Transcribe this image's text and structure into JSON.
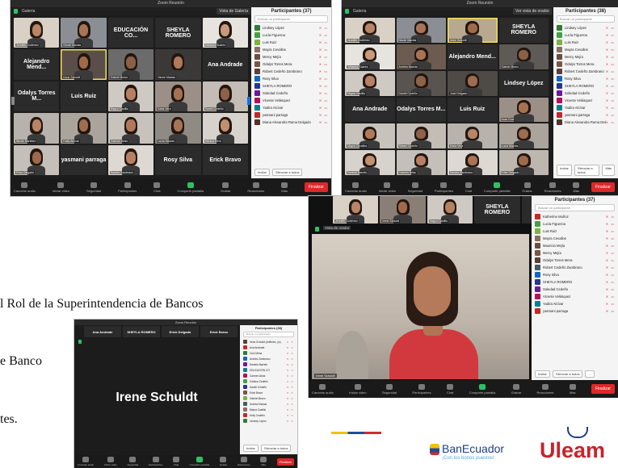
{
  "window1": {
    "title": "Zoom Reunión",
    "top_label": "Galería",
    "view_button": "Vista de Galería",
    "participants_title": "Participantes (37)",
    "search_placeholder": "Buscar un participante",
    "tiles": [
      {
        "type": "video",
        "caption": "Jennifer Gutiérrez",
        "skin": "#b98565",
        "bg": "#d9d1c6"
      },
      {
        "type": "video",
        "caption": "Nicole Macias",
        "skin": "#a87456",
        "bg": "#8b8f95"
      },
      {
        "type": "name",
        "label": "EDUCACIÓN CO..."
      },
      {
        "type": "name",
        "label": "SHEYLA ROMERO"
      },
      {
        "type": "video",
        "caption": "Johanna Suárez",
        "skin": "#c99a7a",
        "bg": "#e7e4e0"
      },
      {
        "type": "name",
        "label": "Alejandro Mend..."
      },
      {
        "type": "video",
        "caption": "Irene Schuldt",
        "skin": "#a06a4a",
        "bg": "#5a4e4a",
        "active": true
      },
      {
        "type": "video",
        "caption": "Gabriel Bravo",
        "skin": "#8a6048",
        "bg": "#6b6b6b"
      },
      {
        "type": "video",
        "caption": "Nicole Macias",
        "skin": "#b07a5a",
        "bg": "#3b3838"
      },
      {
        "type": "name",
        "label": "Ana Andrade"
      },
      {
        "type": "name",
        "label": "Odalys Torres M..."
      },
      {
        "type": "name",
        "label": "Luis Ruiz"
      },
      {
        "type": "video",
        "caption": "Mayra Castillo",
        "skin": "#b68162",
        "bg": "#cfc9c3"
      },
      {
        "type": "video",
        "caption": "Karla Vera",
        "skin": "#a67252",
        "bg": "#9b8f88"
      },
      {
        "type": "video",
        "caption": "Daniel Cedeño",
        "skin": "#8e6248",
        "bg": "#c3bdb5"
      },
      {
        "type": "video",
        "caption": "Nicole Martinez",
        "skin": "#b98565",
        "bg": "#b7b3ac"
      },
      {
        "type": "video",
        "caption": "Katty Alcívar",
        "skin": "#9e6c50",
        "bg": "#aaa49c"
      },
      {
        "type": "video",
        "caption": "Carmen Arias",
        "skin": "#b07a5a",
        "bg": "#c7c2bb"
      },
      {
        "type": "video",
        "caption": "Lucía Macías",
        "skin": "#a87456",
        "bg": "#8f8a84"
      },
      {
        "type": "video",
        "caption": "Mónica Mero",
        "skin": "#c09070",
        "bg": "#d7d2cc"
      },
      {
        "type": "video",
        "caption": "Erika Delgado",
        "skin": "#9d6a4c",
        "bg": "#c4bfb8"
      },
      {
        "type": "name",
        "label": "yasmani parraga"
      },
      {
        "type": "video",
        "caption": "Sandra Zambrano",
        "skin": "#b68162",
        "bg": "#ddd8d2"
      },
      {
        "type": "name",
        "label": "Rosy Silva"
      },
      {
        "type": "name",
        "label": "Erick Bravo"
      }
    ],
    "participants": [
      {
        "name": "Lindsey López",
        "color": "#2e7d32"
      },
      {
        "name": "Lucía Figueroa",
        "color": "#43a047"
      },
      {
        "name": "Luis Ruiz",
        "color": "#7cb342"
      },
      {
        "name": "Mayra Cevallos",
        "color": "#8d6e63"
      },
      {
        "name": "Mercy Mejía",
        "color": "#6d4c41"
      },
      {
        "name": "Odalys Torres Mera",
        "color": "#795548"
      },
      {
        "name": "Robert Cedeño Zambrano",
        "color": "#5d4037"
      },
      {
        "name": "Rosy Silva",
        "color": "#1565c0"
      },
      {
        "name": "SHEYLA ROMERO",
        "color": "#283593"
      },
      {
        "name": "Soledad Cedeño",
        "color": "#6a1b9a"
      },
      {
        "name": "Vicente Velásquez",
        "color": "#ad1457"
      },
      {
        "name": "Yadira Alcívar",
        "color": "#00838f"
      },
      {
        "name": "yasmani parraga",
        "color": "#c62828"
      },
      {
        "name": "Diana Alexandra Rama Delgado",
        "color": "#4e342e"
      }
    ],
    "panel_buttons": [
      "Invitar",
      "Silenciar a todos"
    ],
    "toolbar": [
      "Cancelar audio",
      "Iniciar video",
      "Seguridad",
      "Participantes",
      "Chat",
      "Compartir pantalla",
      "Grabar",
      "Reacciones",
      "Más"
    ],
    "end_label": "Finalizar"
  },
  "window2": {
    "title": "Zoom Reunión",
    "top_label": "Galería",
    "view_button": "Ver vista de orador",
    "participants_title": "Participantes (38)",
    "search_placeholder": "Buscar un participante",
    "tiles": [
      {
        "type": "video",
        "caption": "Jennifer Gutiérrez",
        "skin": "#b98565",
        "bg": "#d9d1c6"
      },
      {
        "type": "video",
        "caption": "Nicole Macias",
        "skin": "#a87456",
        "bg": "#8b8f95"
      },
      {
        "type": "video",
        "caption": "Irene Schuldt",
        "skin": "#a06a4a",
        "bg": "#b8a890",
        "active": true
      },
      {
        "type": "name",
        "label": "SHEYLA ROMERO"
      },
      {
        "type": "video",
        "caption": "Johanna Suárez",
        "skin": "#c99a7a",
        "bg": "#e7e4e0"
      },
      {
        "type": "video",
        "caption": "Andrea Macías",
        "skin": "#a87456",
        "bg": "#6b5b50"
      },
      {
        "type": "name",
        "label": "Alejandro Mend..."
      },
      {
        "type": "video",
        "caption": "Gabriel Bravo",
        "skin": "#8a6048",
        "bg": "#5e5a55"
      },
      {
        "type": "video",
        "caption": "Mayra Castillo",
        "skin": "#b68162",
        "bg": "#cfc9c3"
      },
      {
        "type": "video",
        "caption": "Daniel Cedeño",
        "skin": "#8e6248",
        "bg": "#5a5450"
      },
      {
        "type": "video",
        "caption": "José Delgado",
        "skin": "#9e6c50",
        "bg": "#4e4a46"
      },
      {
        "type": "name",
        "label": "Lindsey López"
      },
      {
        "type": "name",
        "label": "Ana Andrade"
      },
      {
        "type": "name",
        "label": "Odalys Torres M..."
      },
      {
        "type": "name",
        "label": "Luis Ruiz"
      },
      {
        "type": "video",
        "caption": "Juan Cruz",
        "skin": "#a67252",
        "bg": "#9b8f88"
      },
      {
        "type": "video",
        "caption": "Mayra Cevallos",
        "skin": "#b07a5a",
        "bg": "#c7c2bb"
      },
      {
        "type": "video",
        "caption": "Rafael Cedeño",
        "skin": "#8e6248",
        "bg": "#c3bdb5"
      },
      {
        "type": "video",
        "caption": "Karla Vera",
        "skin": "#b98565",
        "bg": "#b7b3ac"
      },
      {
        "type": "video",
        "caption": "Lucía Macías",
        "skin": "#9e6c50",
        "bg": "#aaa49c"
      },
      {
        "type": "video",
        "caption": "Daniela Barreto",
        "skin": "#c09070",
        "bg": "#d7d2cc"
      },
      {
        "type": "video",
        "caption": "Carmen Arias",
        "skin": "#b68162",
        "bg": "#c4bfb8"
      },
      {
        "type": "video",
        "caption": "Sandra Zambrano",
        "skin": "#a87456",
        "bg": "#ddd8d2"
      },
      {
        "type": "video",
        "caption": "Erika Delgado",
        "skin": "#9d6a4c",
        "bg": "#bdb7b0"
      }
    ],
    "participants": [
      {
        "name": "Lindsey López",
        "color": "#2e7d32"
      },
      {
        "name": "Lucía Figueroa",
        "color": "#43a047"
      },
      {
        "name": "Luis Ruiz",
        "color": "#7cb342"
      },
      {
        "name": "Mayra Cevallos",
        "color": "#8d6e63"
      },
      {
        "name": "Mercy Mejía",
        "color": "#6d4c41"
      },
      {
        "name": "Odalys Torres Mera",
        "color": "#795548"
      },
      {
        "name": "Robert Cedeño Zambrano",
        "color": "#5d4037"
      },
      {
        "name": "Rosy Silva",
        "color": "#1565c0"
      },
      {
        "name": "SHEYLA ROMERO",
        "color": "#283593"
      },
      {
        "name": "Soledad Cedeño",
        "color": "#6a1b9a"
      },
      {
        "name": "Vicente Velásquez",
        "color": "#ad1457"
      },
      {
        "name": "Yadira Alcívar",
        "color": "#00838f"
      },
      {
        "name": "yasmani parraga",
        "color": "#c62828"
      },
      {
        "name": "Diana Alexandra Rama Delgado",
        "color": "#4e342e"
      }
    ],
    "panel_buttons": [
      "Invitar",
      "Silenciar a todos",
      "Más"
    ],
    "toolbar": [
      "Cancelar audio",
      "Iniciar video",
      "Seguridad",
      "Participantes",
      "Chat",
      "Compartir pantalla",
      "Grabar",
      "Reacciones",
      "Más"
    ],
    "end_label": "Finalizar"
  },
  "window3": {
    "strip": [
      {
        "type": "video",
        "caption": "Jennifer Gutiérrez",
        "skin": "#b98565",
        "bg": "#d9d1c6"
      },
      {
        "type": "video",
        "caption": "Irene Schuldt",
        "skin": "#a06a4a",
        "bg": "#8a7f76"
      },
      {
        "type": "video",
        "caption": "Mayra Castillo",
        "skin": "#b68162",
        "bg": "#cfc9c3"
      },
      {
        "type": "name",
        "label": "SHEYLA ROMERO"
      },
      {
        "type": "name",
        "label": "Alejandro Mend..."
      }
    ],
    "speaker_caption": "Irene Schuldt",
    "view_label": "Vista de orador",
    "participants_title": "Participantes (37)",
    "search_placeholder": "Buscar un participante",
    "participants": [
      {
        "name": "Katherine Muñoz",
        "color": "#c62828"
      },
      {
        "name": "Lucía Figueroa",
        "color": "#43a047"
      },
      {
        "name": "Luis Ruiz",
        "color": "#7cb342"
      },
      {
        "name": "Mayra Cevallos",
        "color": "#8d6e63"
      },
      {
        "name": "Mauricio Mejía",
        "color": "#6d4c41"
      },
      {
        "name": "Mercy Mejía",
        "color": "#795548"
      },
      {
        "name": "Odalys Torres Mera",
        "color": "#5d4037"
      },
      {
        "name": "Robert Cedeño Zambrano",
        "color": "#455a64"
      },
      {
        "name": "Rosy Silva",
        "color": "#1565c0"
      },
      {
        "name": "SHEYLA ROMERO",
        "color": "#283593"
      },
      {
        "name": "Soledad Cedeño",
        "color": "#6a1b9a"
      },
      {
        "name": "Vicente Velásquez",
        "color": "#ad1457"
      },
      {
        "name": "Yadira Alcívar",
        "color": "#00838f"
      },
      {
        "name": "yasmani parraga",
        "color": "#c62828"
      }
    ],
    "panel_buttons": [
      "Invitar",
      "Silenciar a todos",
      "..."
    ],
    "toolbar": [
      "Cancelar audio",
      "Iniciar video",
      "Seguridad",
      "Participantes",
      "Chat",
      "Compartir pantalla",
      "Grabar",
      "Reacciones",
      "Más"
    ],
    "end_label": "Finalizar"
  },
  "window4": {
    "title": "Zoom Reunión",
    "strip": [
      "Ana Andrade",
      "SHEYLA ROMERO",
      "Erick Delgado",
      "Erick Bravo"
    ],
    "speaker_name": "Irene Schuldt",
    "participants_title": "Participantes (38)",
    "search_placeholder": "Buscar un participante",
    "participants": [
      {
        "name": "Irene Schuldt (Anfitrión, yo)",
        "color": "#5d4037"
      },
      {
        "name": "Ana Andrade",
        "color": "#c62828"
      },
      {
        "name": "Ceci Mena",
        "color": "#2e7d32"
      },
      {
        "name": "Andrés Zambrano",
        "color": "#1565c0"
      },
      {
        "name": "Daniela Barreto",
        "color": "#6a1b9a"
      },
      {
        "name": "EDUCACIÓN CO",
        "color": "#00838f"
      },
      {
        "name": "Carmen Arias",
        "color": "#ad1457"
      },
      {
        "name": "Cristina Cedeño",
        "color": "#43a047"
      },
      {
        "name": "Daniel Cedeño",
        "color": "#283593"
      },
      {
        "name": "Erick Bravo",
        "color": "#795548"
      },
      {
        "name": "Gabriel Bravo",
        "color": "#7cb342"
      },
      {
        "name": "Andrea Macias",
        "color": "#455a64"
      },
      {
        "name": "Mayra Castillo",
        "color": "#8d6e63"
      },
      {
        "name": "Kelly Cedeño",
        "color": "#c62828"
      },
      {
        "name": "Lindsey López",
        "color": "#2e7d32"
      }
    ],
    "panel_buttons": [
      "Invitar",
      "Silenciar a todos"
    ],
    "toolbar": [
      "Cancelar audio",
      "Iniciar video",
      "Seguridad",
      "Participantes",
      "Chat",
      "Compartir pantalla",
      "Grabar",
      "Reacciones",
      "Más"
    ],
    "end_label": "Finalizar"
  },
  "document": {
    "line1": "l Rol de la Superintendencia de Bancos",
    "line2": "e Banco",
    "line3": "tes."
  },
  "logos": {
    "banecuador_name": "BanEcuador",
    "banecuador_tagline": "¡Con los bonos puestos!",
    "uleam_name": "Uleam"
  }
}
